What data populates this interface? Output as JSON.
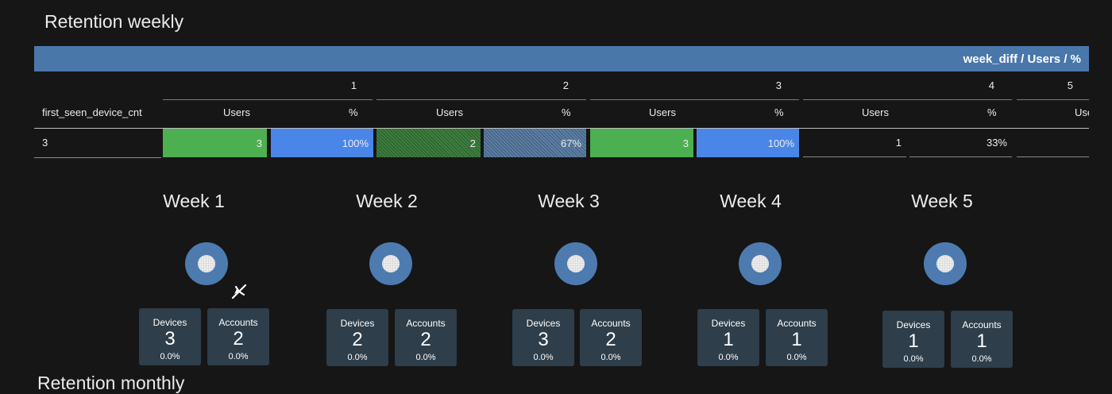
{
  "titles": {
    "weekly": "Retention weekly",
    "monthly": "Retention monthly"
  },
  "pivot": {
    "header": "week_diff / Users / %",
    "row_dimension": "first_seen_device_cnt",
    "weeks": [
      "1",
      "2",
      "3",
      "4",
      "5"
    ],
    "col_users": "Users",
    "col_pct": "%",
    "col_partial": "Use",
    "row": {
      "label": "3",
      "cells": [
        {
          "users": "3",
          "pct": "100%"
        },
        {
          "users": "2",
          "pct": "67%"
        },
        {
          "users": "3",
          "pct": "100%"
        },
        {
          "users": "1",
          "pct": "33%"
        }
      ]
    }
  },
  "weeks": [
    {
      "title": "Week 1",
      "devices_label": "Devices",
      "devices": "3",
      "devices_pct": "0.0%",
      "accounts_label": "Accounts",
      "accounts": "2",
      "accounts_pct": "0.0%"
    },
    {
      "title": "Week 2",
      "devices_label": "Devices",
      "devices": "2",
      "devices_pct": "0.0%",
      "accounts_label": "Accounts",
      "accounts": "2",
      "accounts_pct": "0.0%"
    },
    {
      "title": "Week 3",
      "devices_label": "Devices",
      "devices": "3",
      "devices_pct": "0.0%",
      "accounts_label": "Accounts",
      "accounts": "2",
      "accounts_pct": "0.0%"
    },
    {
      "title": "Week 4",
      "devices_label": "Devices",
      "devices": "1",
      "devices_pct": "0.0%",
      "accounts_label": "Accounts",
      "accounts": "1",
      "accounts_pct": "0.0%"
    },
    {
      "title": "Week 5",
      "devices_label": "Devices",
      "devices": "1",
      "devices_pct": "0.0%",
      "accounts_label": "Accounts",
      "accounts": "1",
      "accounts_pct": "0.0%"
    }
  ],
  "colors": {
    "header_bar": "#4a77aa",
    "users_cell": "#4caf50",
    "pct_cell": "#4a86e8",
    "ring": "#4d7bb0",
    "stat_box": "#2e3e4a"
  }
}
